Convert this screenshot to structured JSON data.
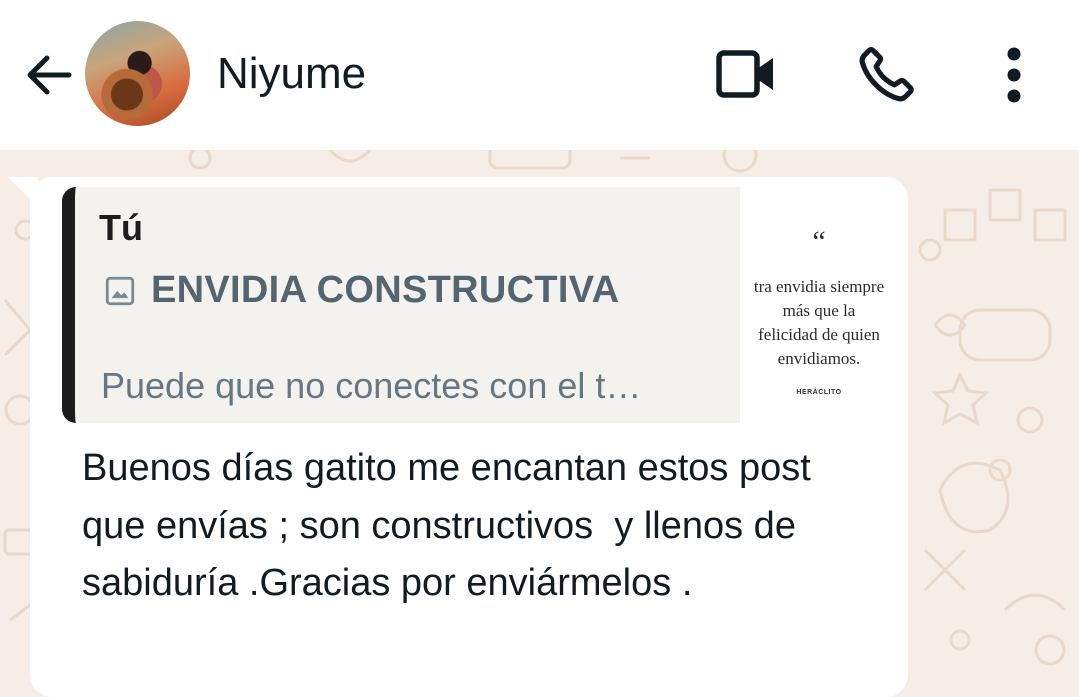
{
  "header": {
    "contact_name": "Niyume",
    "icons": {
      "back": "arrow-left-icon",
      "video": "video-camera-icon",
      "call": "phone-icon",
      "menu": "more-vertical-icon"
    }
  },
  "colors": {
    "header_bg": "#ffffff",
    "wallpaper_bg": "#f5ede6",
    "bubble_bg": "#ffffff",
    "quote_bar": "#1c1c1c",
    "quote_bg": "#f4f2ef",
    "text_primary": "#111b21",
    "text_secondary": "#667781"
  },
  "reply_quote": {
    "author": "Tú",
    "media_icon": "image-icon",
    "title": "ENVIDIA CONSTRUCTIVA",
    "preview": "Puede que no conectes con el t…",
    "thumbnail": {
      "quote_mark": "“",
      "text": "tra envidia siempre\nmás que la\nfelicidad de quien\nenvidiamos.",
      "author": "HERÁCLITO"
    }
  },
  "message": {
    "text": "Buenos días gatito me encantan estos post que envías ; son constructivos  y llenos de sabiduría .Gracias por enviármelos ."
  }
}
